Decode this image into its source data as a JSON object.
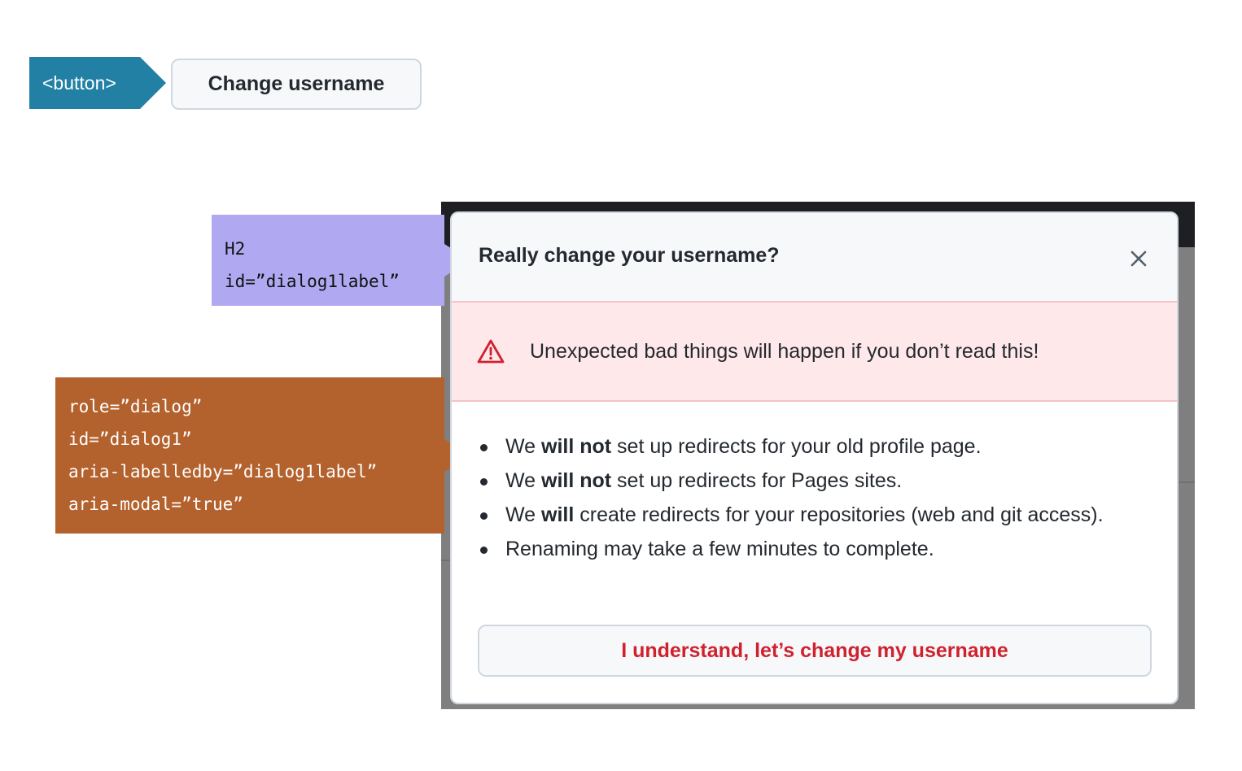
{
  "annotations": {
    "button_tag": "<button>",
    "h2_tag": [
      "H2",
      "id=”dialog1label”"
    ],
    "dialog_tag": [
      "role=”dialog”",
      "id=”dialog1”",
      "aria-labelledby=”dialog1label”",
      "aria-modal=”true”"
    ]
  },
  "trigger_button": {
    "label": "Change username"
  },
  "dialog": {
    "title": "Really change your username?",
    "close_icon": "close-icon",
    "warning": {
      "icon": "alert-icon",
      "text": "Unexpected bad things will happen if you don’t read this!"
    },
    "items": [
      {
        "pre": "We ",
        "bold": "will not",
        "post": " set up redirects for your old profile page."
      },
      {
        "pre": "We ",
        "bold": "will not",
        "post": " set up redirects for Pages sites."
      },
      {
        "pre": "We ",
        "bold": "will",
        "post": " create redirects for your repositories (web and git access)."
      },
      {
        "pre": "",
        "bold": "",
        "post": "Renaming may take a few minutes to complete."
      }
    ],
    "confirm_label": "I understand, let’s change my username"
  },
  "colors": {
    "button_tag": "#2280a5",
    "h2_tag": "#b0a9f1",
    "dialog_tag": "#b3612d",
    "danger": "#cf222e",
    "flash_bg": "#ffe8ea"
  }
}
